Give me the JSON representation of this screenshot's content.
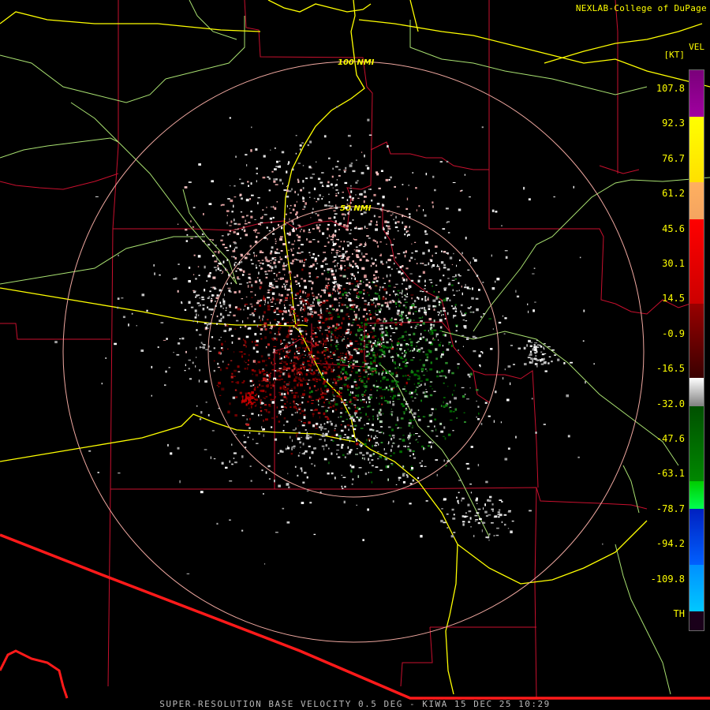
{
  "header": {
    "credit": "NEXLAB-College of DuPage"
  },
  "footer": {
    "product_line": "SUPER-RESOLUTION BASE VELOCITY 0.5 DEG - KIWA 15 DEC 25 10:29"
  },
  "map": {
    "rings": [
      {
        "label": "50 NMI"
      },
      {
        "label": "100 NMI"
      }
    ],
    "colors": {
      "state_border": "#ff1a1a",
      "county_border": "#c8102e",
      "highway": "#ffff00",
      "secondary_road": "#a8e070",
      "range_ring": "#f0a8a0"
    }
  },
  "legend": {
    "product": "VEL",
    "units": "[KT]",
    "labels": [
      "107.8",
      "92.3",
      "76.7",
      "61.2",
      "45.6",
      "30.1",
      "14.5",
      "-0.9",
      "-16.5",
      "-32.0",
      "-47.6",
      "-63.1",
      "-78.7",
      "-94.2",
      "-109.8",
      "TH"
    ],
    "colors": [
      "#800080",
      "#ffff00",
      "#f4a460",
      "#ff0000",
      "#8b0000",
      "#ffffff",
      "#006400",
      "#00ff00",
      "#0000ff",
      "#00bfff",
      "#1a001a"
    ]
  }
}
